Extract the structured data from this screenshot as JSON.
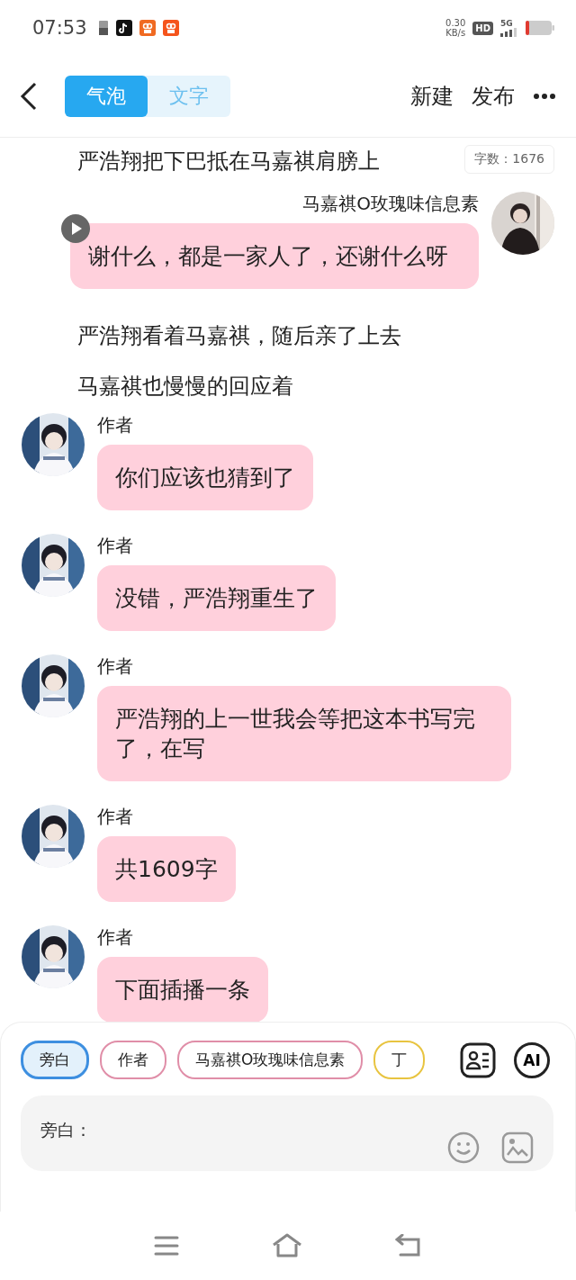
{
  "status_bar": {
    "time": "07:53",
    "speed_value": "0.30",
    "speed_unit": "KB/s",
    "hd": "HD",
    "network": "5G"
  },
  "header": {
    "tabs": [
      {
        "label": "气泡",
        "selected": true
      },
      {
        "label": "文字",
        "selected": false
      }
    ],
    "actions": [
      "新建",
      "发布"
    ]
  },
  "word_count": "字数：1676",
  "messages": [
    {
      "kind": "narration",
      "text": "严浩翔把下巴抵在马嘉祺肩膀上"
    },
    {
      "kind": "right",
      "name": "马嘉祺O玫瑰味信息素",
      "text": "谢什么，都是一家人了，还谢什么呀"
    },
    {
      "kind": "narration",
      "text": "严浩翔看着马嘉祺，随后亲了上去"
    },
    {
      "kind": "narration",
      "text": "马嘉祺也慢慢的回应着"
    },
    {
      "kind": "left",
      "name": "作者",
      "text": "你们应该也猜到了"
    },
    {
      "kind": "left",
      "name": "作者",
      "text": "没错，严浩翔重生了"
    },
    {
      "kind": "left",
      "name": "作者",
      "text": "严浩翔的上一世我会等把这本书写完了，在写"
    },
    {
      "kind": "left",
      "name": "作者",
      "text": "共1609字"
    },
    {
      "kind": "left",
      "name": "作者",
      "text": "下面插播一条"
    }
  ],
  "roles": [
    {
      "label": "旁白",
      "selected": true,
      "color": "#3d8fe0"
    },
    {
      "label": "作者",
      "selected": false,
      "color": "#e08ea8"
    },
    {
      "label": "马嘉祺O玫瑰味信息素",
      "selected": false,
      "color": "#e08ea8"
    },
    {
      "label": "丁",
      "selected": false,
      "color": "#e8c440"
    }
  ],
  "ai_button": "AI",
  "input": {
    "placeholder": "旁白："
  }
}
